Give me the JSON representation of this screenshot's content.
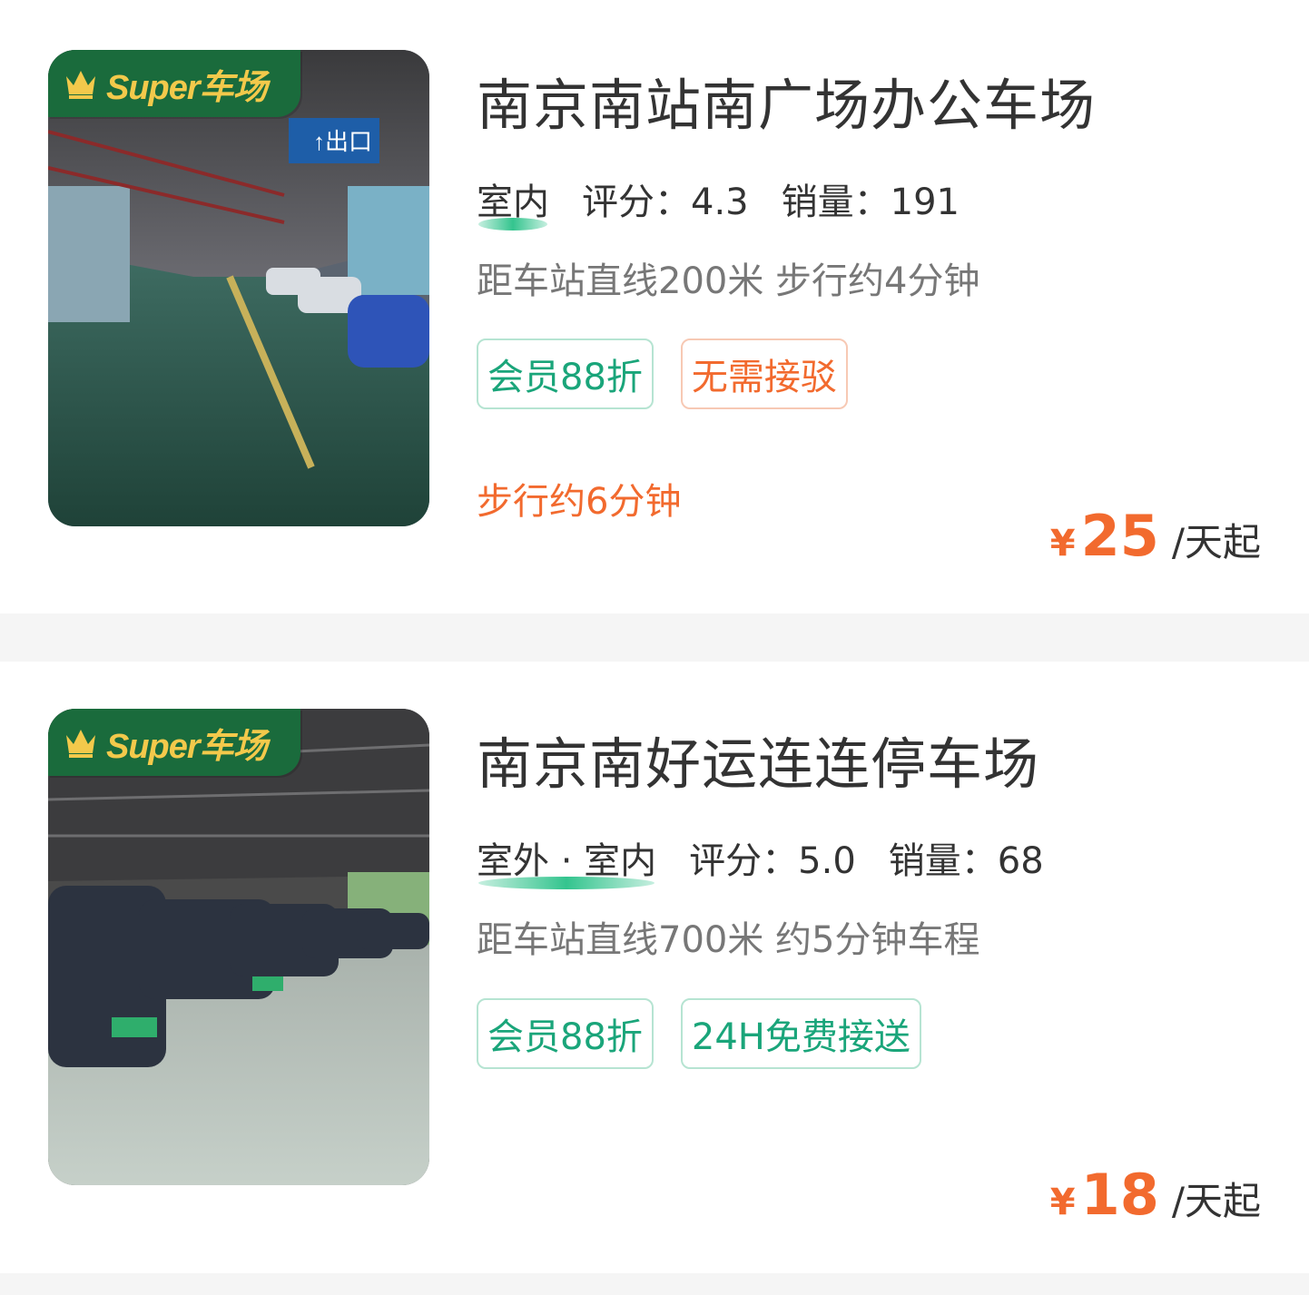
{
  "listings": [
    {
      "badge": "Super车场",
      "title": "南京南站南广场办公车场",
      "location_type": "室内",
      "rating_label": "评分：",
      "rating": "4.3",
      "sales_label": "销量：",
      "sales": "191",
      "distance": "距车站直线200米 步行约4分钟",
      "tags": [
        {
          "text": "会员88折",
          "style": "green"
        },
        {
          "text": "无需接驳",
          "style": "orange"
        }
      ],
      "walk_note": "步行约6分钟",
      "currency": "¥",
      "price": "25",
      "price_unit": "/天起"
    },
    {
      "badge": "Super车场",
      "title": "南京南好运连连停车场",
      "location_type": "室外 · 室内",
      "rating_label": "评分：",
      "rating": "5.0",
      "sales_label": "销量：",
      "sales": "68",
      "distance": "距车站直线700米 约5分钟车程",
      "tags": [
        {
          "text": "会员88折",
          "style": "green"
        },
        {
          "text": "24H免费接送",
          "style": "green"
        }
      ],
      "walk_note": "",
      "currency": "¥",
      "price": "18",
      "price_unit": "/天起"
    }
  ],
  "colors": {
    "accent_orange": "#f26a2e",
    "accent_green": "#1aa57a",
    "badge_green": "#1a6b3c",
    "badge_text": "#f3c94b"
  }
}
